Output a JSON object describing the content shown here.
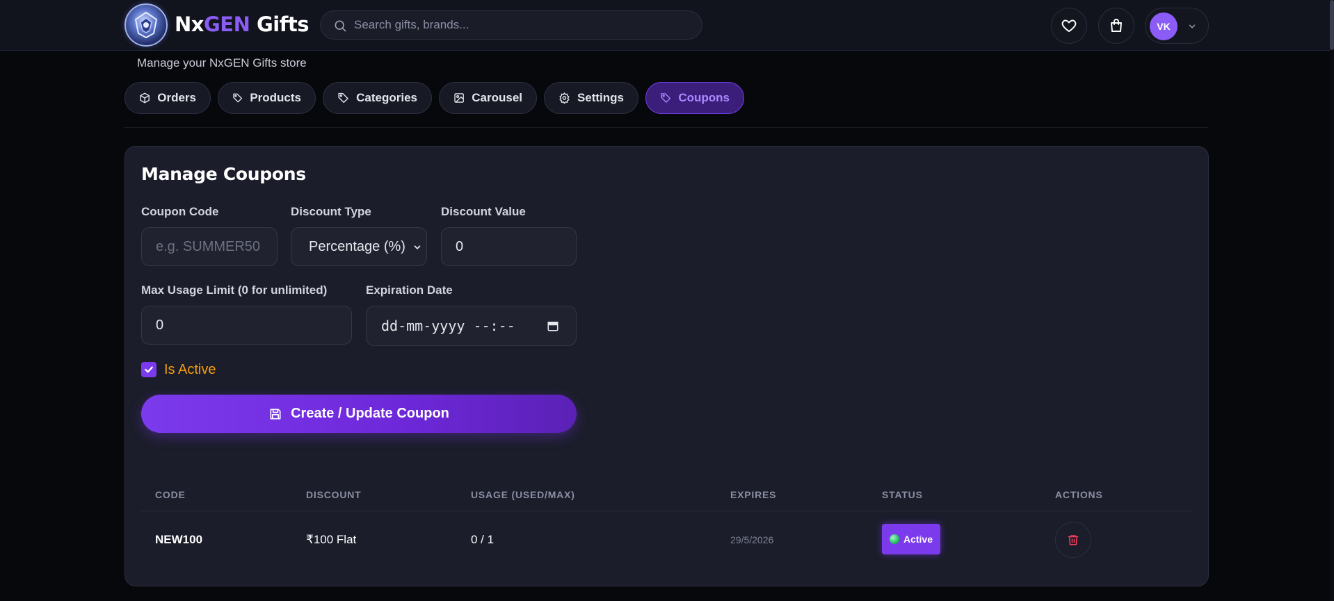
{
  "header": {
    "brand_nx": "Nx",
    "brand_gen": "GEN",
    "brand_gifts": " Gifts",
    "search_placeholder": "Search gifts, brands...",
    "avatar_initials": "VK"
  },
  "subtitle": "Manage your NxGEN Gifts store",
  "tabs": [
    {
      "label": "Orders",
      "icon": "box-icon"
    },
    {
      "label": "Products",
      "icon": "tag-icon"
    },
    {
      "label": "Categories",
      "icon": "tag-icon"
    },
    {
      "label": "Carousel",
      "icon": "image-icon"
    },
    {
      "label": "Settings",
      "icon": "gear-icon"
    },
    {
      "label": "Coupons",
      "icon": "tag-icon",
      "active": true
    }
  ],
  "form": {
    "title": "Manage Coupons",
    "coupon_code_label": "Coupon Code",
    "coupon_code_placeholder": "e.g. SUMMER50",
    "coupon_code_value": "",
    "discount_type_label": "Discount Type",
    "discount_type_value": "Percentage (%)",
    "discount_value_label": "Discount Value",
    "discount_value": "0",
    "max_usage_label": "Max Usage Limit (0 for unlimited)",
    "max_usage_value": "0",
    "expiration_label": "Expiration Date",
    "expiration_placeholder": "dd-mm-yyyy --:--",
    "is_active_label": "Is Active",
    "is_active_checked": true,
    "submit_label": "Create / Update Coupon"
  },
  "table": {
    "headers": [
      "CODE",
      "DISCOUNT",
      "USAGE (USED/MAX)",
      "EXPIRES",
      "STATUS",
      "ACTIONS"
    ],
    "rows": [
      {
        "code": "NEW100",
        "discount": "₹100 Flat",
        "usage": "0 / 1",
        "expires": "29/5/2026",
        "status": "Active"
      }
    ]
  },
  "colors": {
    "accent": "#7c3aed",
    "accent_light": "#a98bff",
    "background": "#07080c",
    "card": "#1b1d2a",
    "active_label": "#f59e0b",
    "danger": "#f43f5e",
    "status_dot": "#22c55e"
  }
}
